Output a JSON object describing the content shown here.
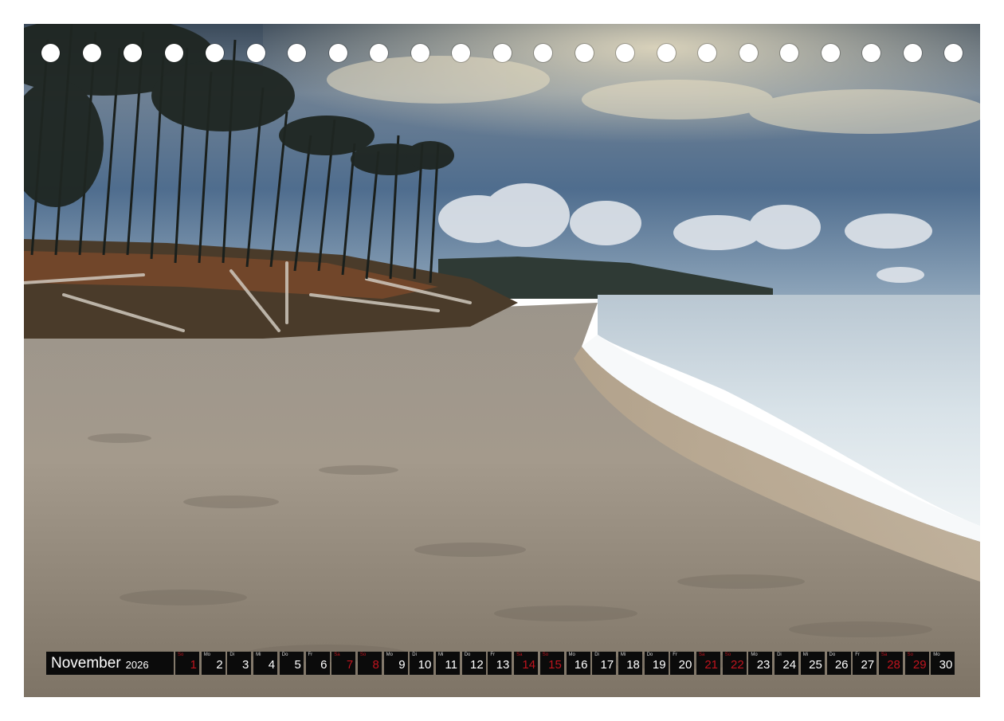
{
  "calendar": {
    "month": "November",
    "year": "2026",
    "weekend_color": "#c0141e",
    "days": [
      {
        "d": "1",
        "n": "So",
        "w": true
      },
      {
        "d": "2",
        "n": "Mo",
        "w": false
      },
      {
        "d": "3",
        "n": "Di",
        "w": false
      },
      {
        "d": "4",
        "n": "Mi",
        "w": false
      },
      {
        "d": "5",
        "n": "Do",
        "w": false
      },
      {
        "d": "6",
        "n": "Fr",
        "w": false
      },
      {
        "d": "7",
        "n": "Sa",
        "w": true
      },
      {
        "d": "8",
        "n": "So",
        "w": true
      },
      {
        "d": "9",
        "n": "Mo",
        "w": false
      },
      {
        "d": "10",
        "n": "Di",
        "w": false
      },
      {
        "d": "11",
        "n": "Mi",
        "w": false
      },
      {
        "d": "12",
        "n": "Do",
        "w": false
      },
      {
        "d": "13",
        "n": "Fr",
        "w": false
      },
      {
        "d": "14",
        "n": "Sa",
        "w": true
      },
      {
        "d": "15",
        "n": "So",
        "w": true
      },
      {
        "d": "16",
        "n": "Mo",
        "w": false
      },
      {
        "d": "17",
        "n": "Di",
        "w": false
      },
      {
        "d": "18",
        "n": "Mi",
        "w": false
      },
      {
        "d": "19",
        "n": "Do",
        "w": false
      },
      {
        "d": "20",
        "n": "Fr",
        "w": false
      },
      {
        "d": "21",
        "n": "Sa",
        "w": true
      },
      {
        "d": "22",
        "n": "So",
        "w": true
      },
      {
        "d": "23",
        "n": "Mo",
        "w": false
      },
      {
        "d": "24",
        "n": "Di",
        "w": false
      },
      {
        "d": "25",
        "n": "Mi",
        "w": false
      },
      {
        "d": "26",
        "n": "Do",
        "w": false
      },
      {
        "d": "27",
        "n": "Fr",
        "w": false
      },
      {
        "d": "28",
        "n": "Sa",
        "w": true
      },
      {
        "d": "29",
        "n": "So",
        "w": true
      },
      {
        "d": "30",
        "n": "Mo",
        "w": false
      }
    ]
  }
}
